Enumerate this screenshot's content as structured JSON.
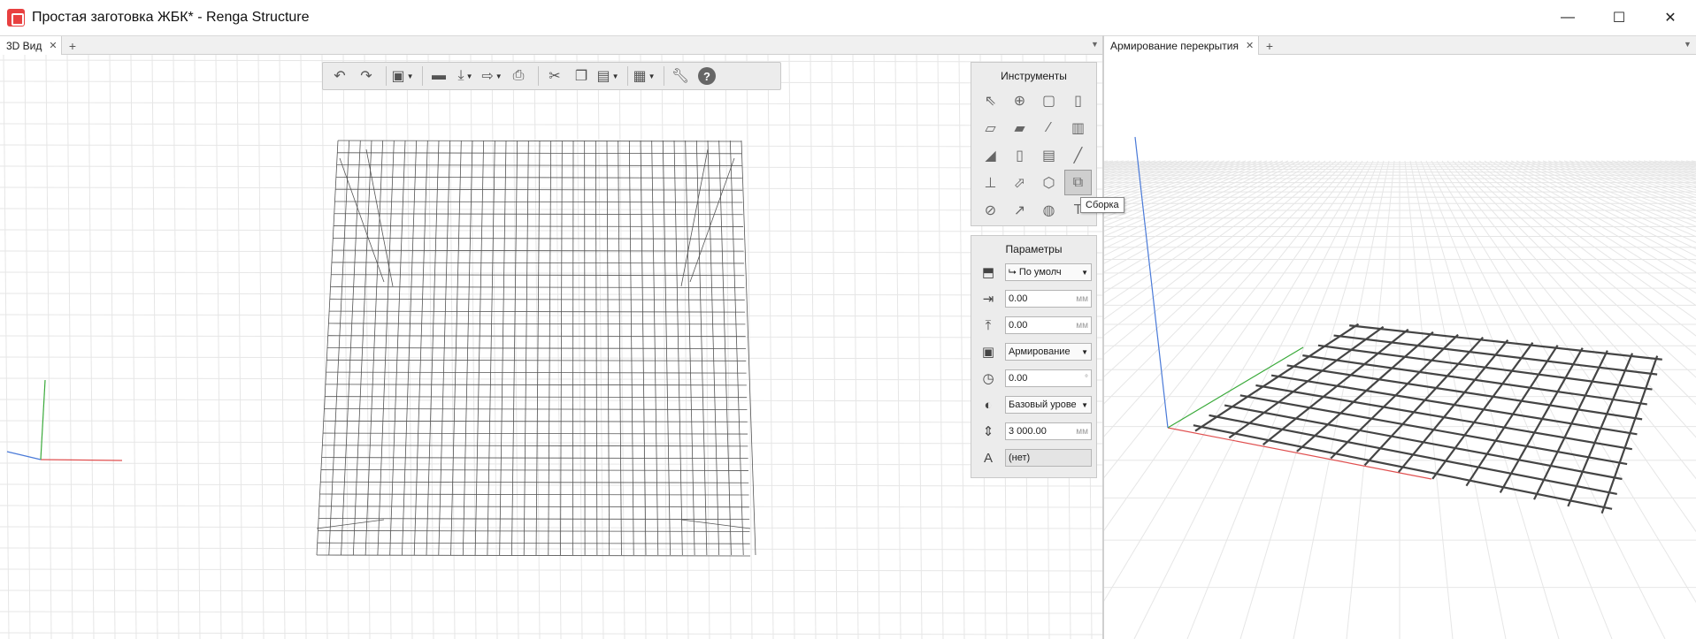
{
  "window": {
    "title": "Простая заготовка ЖБК* - Renga Structure",
    "minimize": "—",
    "maximize": "☐",
    "close": "✕"
  },
  "left_tabs": [
    {
      "label": "3D Вид",
      "close": "✕"
    }
  ],
  "right_tabs": [
    {
      "label": "Армирование перекрытия",
      "close": "✕"
    }
  ],
  "tab_add": "+",
  "tab_menu": "▼",
  "toolbar": {
    "help": "?"
  },
  "tools_panel": {
    "title": "Инструменты",
    "tooltip": "Сборка"
  },
  "params_panel": {
    "title": "Параметры",
    "rows": [
      {
        "icon": "placement-icon",
        "value": "⮡ По умолч",
        "kind": "select"
      },
      {
        "icon": "offset-x-icon",
        "value": "0.00",
        "unit": "мм",
        "kind": "input"
      },
      {
        "icon": "offset-y-icon",
        "value": "0.00",
        "unit": "мм",
        "kind": "input"
      },
      {
        "icon": "style-icon",
        "value": "Армирование",
        "kind": "select"
      },
      {
        "icon": "rotation-icon",
        "value": "0.00",
        "unit": "°",
        "kind": "input"
      },
      {
        "icon": "level-icon",
        "value": "Базовый урове",
        "kind": "select"
      },
      {
        "icon": "elevation-icon",
        "value": "3 000.00",
        "unit": "мм",
        "kind": "input"
      },
      {
        "icon": "mark-icon",
        "value": "(нет)",
        "kind": "readonly"
      }
    ]
  },
  "colors": {
    "axis_x": "#e05050",
    "axis_y": "#3aaa3a",
    "axis_z": "#4a7ad8",
    "grid": "#e6e6e6",
    "rebar_wire": "#555555"
  }
}
